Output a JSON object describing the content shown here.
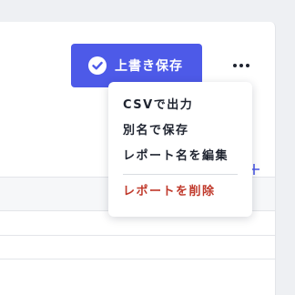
{
  "toolbar": {
    "save_label": "上書き保存"
  },
  "menu": {
    "items": [
      {
        "label": "CSVで出力"
      },
      {
        "label": "別名で保存"
      },
      {
        "label": "レポート名を編集"
      }
    ],
    "danger_item": {
      "label": "レポートを削除"
    }
  },
  "colors": {
    "accent": "#4d5ae8",
    "danger": "#c0392b",
    "text": "#1f2430"
  },
  "icons": {
    "save": "check-circle-icon",
    "more": "more-horizontal-icon",
    "add": "plus-icon"
  }
}
